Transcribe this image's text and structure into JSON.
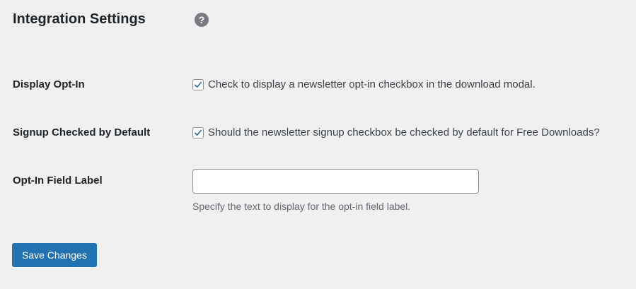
{
  "section": {
    "title": "Integration Settings",
    "help_icon": "question-mark-circle-icon",
    "help_glyph": "?"
  },
  "rows": [
    {
      "label": "Display Opt-In",
      "control": "checkbox",
      "checked": true,
      "description": "Check to display a newsletter opt-in checkbox in the download modal."
    },
    {
      "label": "Signup Checked by Default",
      "control": "checkbox",
      "checked": true,
      "description": "Should the newsletter signup checkbox be checked by default for Free Downloads?"
    },
    {
      "label": "Opt-In Field Label",
      "control": "text",
      "value": "",
      "description": "Specify the text to display for the opt-in field label."
    }
  ],
  "save_button": {
    "label": "Save Changes"
  },
  "colors": {
    "background": "#f0f0f1",
    "primary": "#2271b1",
    "checkmark": "#2271b1",
    "help_icon": "#787c82"
  }
}
